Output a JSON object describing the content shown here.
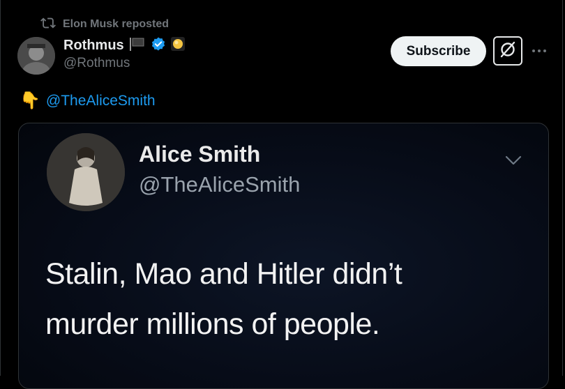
{
  "repost": {
    "text": "Elon Musk reposted",
    "icon": "repost-icon"
  },
  "author": {
    "name": "Rothmus",
    "handle": "@Rothmus",
    "badges": [
      "flag-icon",
      "verified-check-icon",
      "gold-badge-icon"
    ]
  },
  "actions": {
    "subscribe_label": "Subscribe",
    "grok_icon": "grok-icon",
    "more_icon": "more-horizontal-icon"
  },
  "post": {
    "emoji": "👇",
    "mention": "@TheAliceSmith"
  },
  "quoted_image": {
    "name": "Alice Smith",
    "handle": "@TheAliceSmith",
    "lines": [
      "Stalin, Mao and Hitler didn’t",
      "murder millions of people."
    ]
  },
  "colors": {
    "link": "#1d9bf0",
    "verified": "#1d9bf0",
    "background": "#000000",
    "secondary_text": "#71767b"
  }
}
